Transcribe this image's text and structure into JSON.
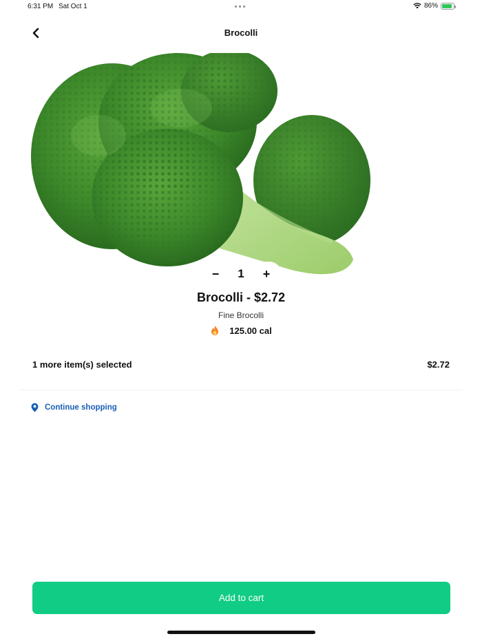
{
  "status_bar": {
    "time": "6:31 PM",
    "date": "Sat Oct 1",
    "battery_percent": "86%",
    "battery_level": 0.86,
    "icons": [
      "wifi-icon",
      "battery-icon"
    ]
  },
  "header": {
    "title": "Brocolli",
    "back_icon": "chevron-left-icon"
  },
  "product": {
    "image_subject": "broccoli",
    "quantity": "1",
    "decrement_label": "−",
    "increment_label": "+",
    "title": "Brocolli - $2.72",
    "subtitle": "Fine Brocolli",
    "calories": "125.00 cal",
    "calories_icon": "flame-icon"
  },
  "summary": {
    "selected_text": "1 more item(s) selected",
    "total": "$2.72"
  },
  "continue_shopping": {
    "label": "Continue shopping",
    "icon": "location-pin-icon"
  },
  "cart_button": {
    "label": "Add to cart"
  },
  "colors": {
    "accent_green": "#11cc84",
    "link_blue": "#1a5fb4",
    "battery_green": "#31c759",
    "flame_orange": "#f5842b"
  }
}
